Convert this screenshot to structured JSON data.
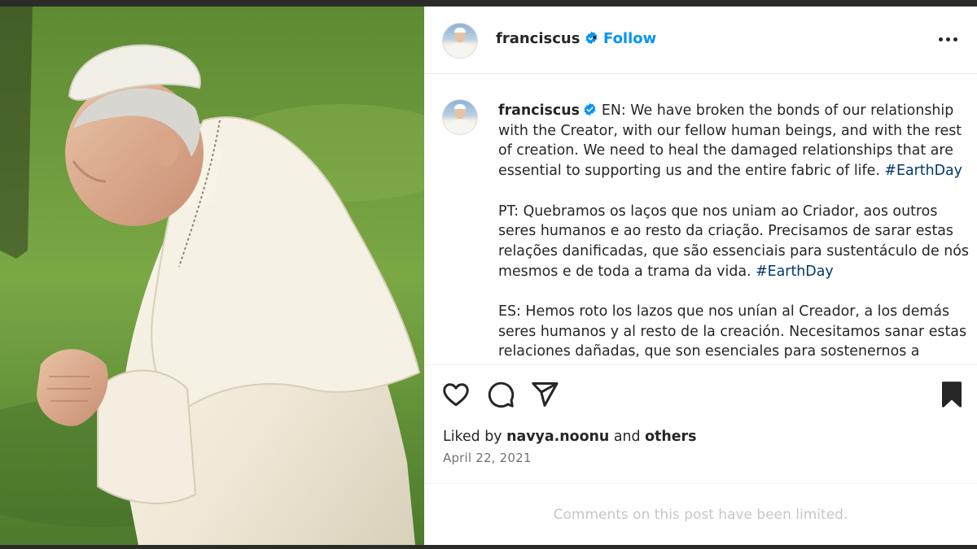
{
  "header": {
    "username": "franciscus",
    "separator": "•",
    "follow_label": "Follow",
    "more_icon": "more-horizontal-icon"
  },
  "caption": {
    "username": "franciscus",
    "paragraphs": [
      {
        "text": "EN: We have broken the bonds of our relationship with the Creator, with our fellow human beings, and with the rest of creation. We need to heal the damaged relationships that are essential to supporting us and the entire fabric of life.",
        "hashtag": "#EarthDay"
      },
      {
        "text": "PT: Quebramos os laços que nos uniam ao Criador, aos outros seres humanos e ao resto da criação. Precisamos de sarar estas relações danificadas, que são essenciais para sustentáculo de nós mesmos e de toda a trama da vida.",
        "hashtag": "#EarthDay"
      },
      {
        "text": "ES: Hemos roto los lazos que nos unían al Creador, a los demás seres humanos y al resto de la creación. Necesitamos sanar estas relaciones dañadas, que son esenciales para sostenernos a nosotros",
        "hashtag": ""
      }
    ]
  },
  "actions": {
    "icons": [
      "heart-icon",
      "comment-icon",
      "share-icon",
      "bookmark-icon"
    ],
    "liked_by_prefix": "Liked by",
    "liked_by_user": "navya.noonu",
    "liked_by_and": "and",
    "liked_by_others": "others",
    "date": "April 22, 2021"
  },
  "comments_notice": "Comments on this post have been limited.",
  "colors": {
    "link_blue": "#0095f6",
    "hashtag": "#00376b",
    "verified": "#0095f6",
    "text": "#262626",
    "muted": "#737373"
  }
}
